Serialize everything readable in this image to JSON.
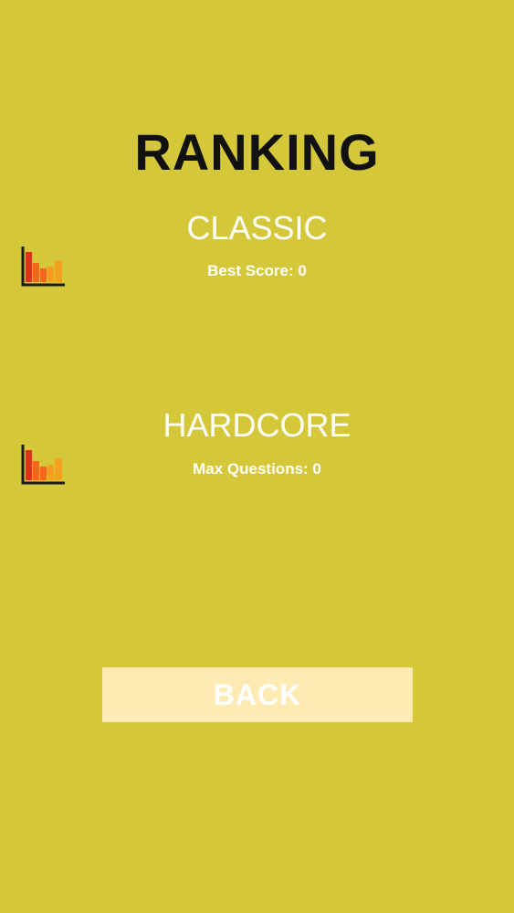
{
  "colors": {
    "background": "#d4c83a",
    "title_text": "#111111",
    "white_text": "#ffffff",
    "button_bg": "#fdebb3",
    "icon_red": "#e0301e",
    "icon_orange": "#ef6a1d",
    "icon_amber": "#f4a21e",
    "icon_axis": "#1a1a1a"
  },
  "header": {
    "title": "RANKING"
  },
  "modes": [
    {
      "title": "CLASSIC",
      "stat": "Best Score: 0",
      "icon": "bar-chart-icon"
    },
    {
      "title": "HARDCORE",
      "stat": "Max Questions: 0",
      "icon": "bar-chart-icon"
    }
  ],
  "footer": {
    "back_label": "BACK"
  }
}
